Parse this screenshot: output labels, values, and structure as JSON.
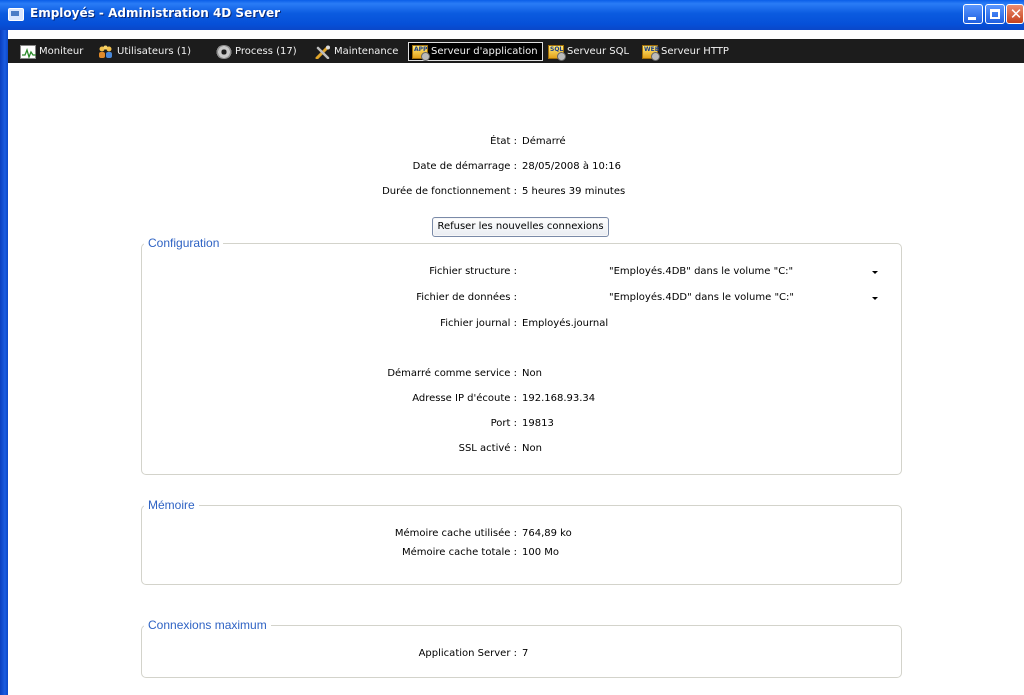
{
  "window": {
    "title": "Employés - Administration 4D Server",
    "colors": {
      "titlebar": "#0a5ee8",
      "toolbar": "#1c1c1c",
      "group_title": "#2f63c4"
    }
  },
  "toolbar": {
    "items": [
      {
        "label": "Moniteur",
        "icon": "monitor-icon"
      },
      {
        "label": "Utilisateurs (1)",
        "icon": "users-icon"
      },
      {
        "label": "Process (17)",
        "icon": "gear-icon"
      },
      {
        "label": "Maintenance",
        "icon": "tools-icon"
      },
      {
        "label": "Serveur d'application",
        "icon": "app-server-icon",
        "active": true
      },
      {
        "label": "Serveur SQL",
        "icon": "sql-server-icon"
      },
      {
        "label": "Serveur HTTP",
        "icon": "web-server-icon"
      }
    ]
  },
  "status": {
    "etat_label": "État :",
    "etat_value": "Démarré",
    "date_label": "Date de démarrage :",
    "date_value": "28/05/2008 à 10:16",
    "duree_label": "Durée de fonctionnement :",
    "duree_value": "5 heures 39 minutes",
    "refuse_button": "Refuser les nouvelles connexions"
  },
  "configuration": {
    "title": "Configuration",
    "structure_label": "Fichier structure :",
    "structure_value": "\"Employés.4DB\" dans le volume \"C:\"",
    "donnees_label": "Fichier de données :",
    "donnees_value": "\"Employés.4DD\" dans le volume \"C:\"",
    "journal_label": "Fichier journal :",
    "journal_value": "Employés.journal",
    "service_label": "Démarré comme service :",
    "service_value": "Non",
    "ip_label": "Adresse IP d'écoute :",
    "ip_value": "192.168.93.34",
    "port_label": "Port :",
    "port_value": "19813",
    "ssl_label": "SSL activé :",
    "ssl_value": "Non"
  },
  "memoire": {
    "title": "Mémoire",
    "utilisee_label": "Mémoire cache utilisée :",
    "utilisee_value": "764,89 ko",
    "totale_label": "Mémoire cache totale :",
    "totale_value": "100 Mo"
  },
  "connexions": {
    "title": "Connexions maximum",
    "app_label": "Application Server :",
    "app_value": "7"
  }
}
